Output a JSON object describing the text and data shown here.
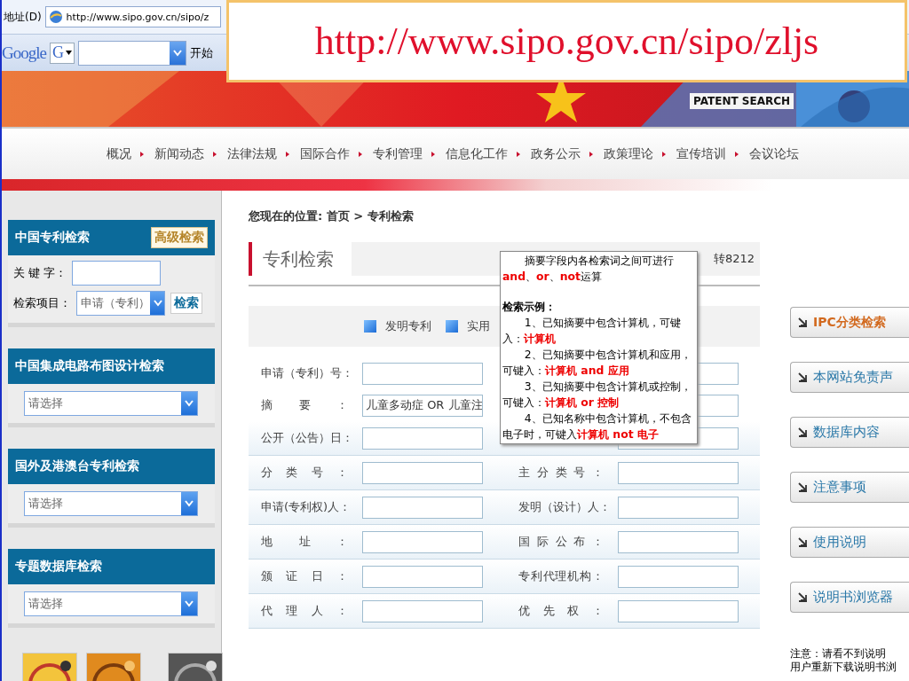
{
  "address_bar": {
    "label": "地址(D)",
    "url": "http://www.sipo.gov.cn/sipo/z"
  },
  "google_bar": {
    "logo": "Google",
    "engine_button": "G",
    "start": "开始"
  },
  "banner": {
    "subtitle": "PATENT SEARCH"
  },
  "callout": {
    "text": "http://www.sipo.gov.cn/sipo/zljs"
  },
  "nav": {
    "items": [
      "概况",
      "新闻动态",
      "法律法规",
      "国际合作",
      "专利管理",
      "信息化工作",
      "政务公示",
      "政策理论",
      "宣传培训",
      "会议论坛"
    ]
  },
  "sidebar": {
    "sections": [
      {
        "kind": "keyword",
        "title": "中国专利检索",
        "advanced_button": "高级检索",
        "keyword_label": "关 键 字：",
        "item_label": "检索项目：",
        "item_value": "申请（专利）",
        "search_button": "检索"
      },
      {
        "kind": "select",
        "title": "中国集成电路布图设计检索",
        "select_value": "请选择"
      },
      {
        "kind": "select",
        "title": "国外及港澳台专利检索",
        "select_value": "请选择"
      },
      {
        "kind": "select",
        "title": "专题数据库检索",
        "select_value": "请选择"
      }
    ]
  },
  "main": {
    "breadcrumb": "您现在的位置: 首页 > 专利检索",
    "title": "专利检索",
    "phone": "转8212",
    "types": [
      {
        "label": "发明专利"
      },
      {
        "label": "实用"
      }
    ],
    "rows": [
      {
        "left_label": "申请（专利）号："
      },
      {
        "left_label": "摘要：",
        "left_value": "儿童多动症 OR 儿童注"
      },
      {
        "left_label": "公开（公告）日："
      },
      {
        "left_label": "分类号：",
        "right_label": "主分类号："
      },
      {
        "left_label": "申请(专利权)人：",
        "right_label": "发明（设计）人："
      },
      {
        "left_label": "地址：",
        "right_label": "国际公布："
      },
      {
        "left_label": "颁证日：",
        "right_label": "专利代理机构："
      },
      {
        "left_label": "代理人：",
        "right_label": "优先权："
      }
    ]
  },
  "tooltip": {
    "lines": [
      {
        "kind": "intro",
        "text": "摘要字段内各检索词之间可进行**and**、**or**、**not**运算"
      },
      {
        "kind": "heading",
        "text": "检索示例："
      },
      {
        "kind": "example",
        "text": "1、已知摘要中包含计算机，可键入：**计算机**"
      },
      {
        "kind": "example",
        "text": "2、已知摘要中包含计算机和应用，可键入：**计算机 and 应用**"
      },
      {
        "kind": "example",
        "text": "3、已知摘要中包含计算机或控制，可键入：**计算机 or 控制**"
      },
      {
        "kind": "example",
        "text": "4、已知名称中包含计算机，不包含电子时，可键入**计算机 not 电子**"
      }
    ]
  },
  "links": [
    {
      "label": "IPC分类检索",
      "selected": true
    },
    {
      "label": "本网站免责声",
      "selected": false
    },
    {
      "label": "数据库内容",
      "selected": false
    },
    {
      "label": "注意事项",
      "selected": false
    },
    {
      "label": "使用说明",
      "selected": false
    },
    {
      "label": "说明书浏览器",
      "selected": false
    }
  ],
  "note": {
    "lines": [
      "注意：请看不到说明",
      "用户重新下载说明书浏"
    ]
  }
}
